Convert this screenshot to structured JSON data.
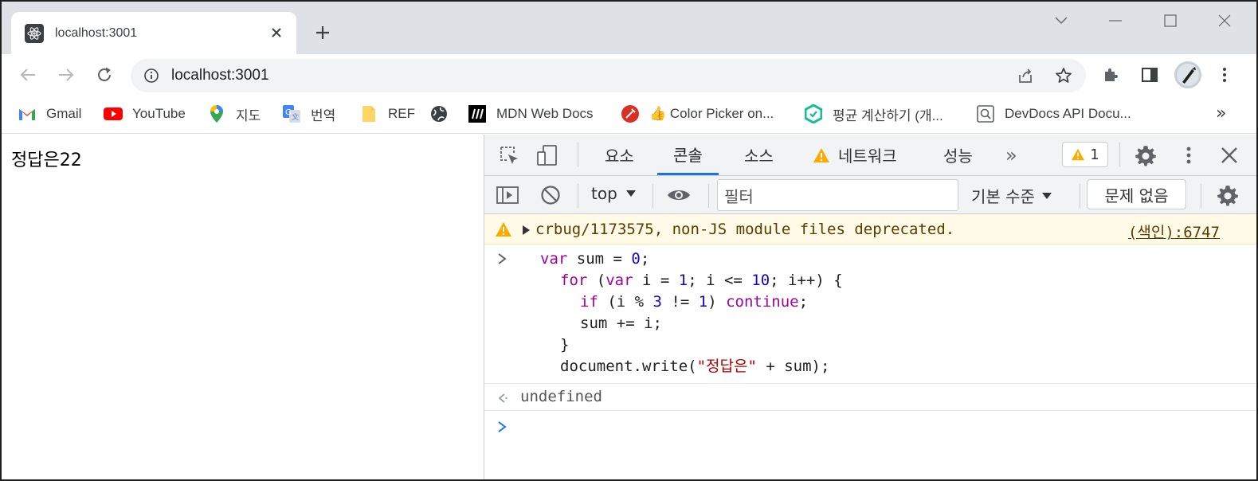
{
  "browser": {
    "tab": {
      "title": "localhost:3001"
    },
    "address_bar": {
      "url": "localhost:3001"
    },
    "bookmarks": [
      {
        "label": "Gmail",
        "icon": "gmail-icon"
      },
      {
        "label": "YouTube",
        "icon": "youtube-icon"
      },
      {
        "label": "지도",
        "icon": "maps-icon"
      },
      {
        "label": "번역",
        "icon": "translate-icon"
      },
      {
        "label": "REF",
        "icon": "folder-icon"
      },
      {
        "label": "",
        "icon": "globe-icon"
      },
      {
        "label": "MDN Web Docs",
        "icon": "mdn-icon"
      },
      {
        "label": "👍 Color Picker on...",
        "icon": "color-picker-icon"
      },
      {
        "label": "평균 계산하기 (개...",
        "icon": "hexagon-icon"
      },
      {
        "label": "DevDocs API Docu...",
        "icon": "devdocs-icon"
      }
    ],
    "bookmarks_more": "»"
  },
  "page": {
    "content_text": "정답은22"
  },
  "devtools": {
    "tabs": [
      "요소",
      "콘솔",
      "소스",
      "네트워크",
      "성능"
    ],
    "active_tab": "콘솔",
    "more_tabs": "»",
    "issues_count": "1",
    "context": "top",
    "filter_placeholder": "필터",
    "levels": "기본 수준",
    "no_issues": "문제 없음",
    "warning": {
      "text": "crbug/1173575, non-JS module files deprecated.",
      "source": "(색인):6747"
    },
    "code": {
      "line1": {
        "a": "var",
        "b": " sum = ",
        "c": "0",
        "d": ";"
      },
      "line2": {
        "a": "for",
        "b": " (",
        "c": "var",
        "d": " i = ",
        "e": "1",
        "f": "; i <= ",
        "g": "10",
        "h": "; i++) {"
      },
      "line3": {
        "a": "if",
        "b": " (i % ",
        "c": "3",
        "d": " != ",
        "e": "1",
        "f": ") ",
        "g": "continue",
        "h": ";"
      },
      "line4": "sum += i;",
      "line5": "}",
      "line6": {
        "a": "document.write(",
        "b": "\"정답은\"",
        "c": " + sum);"
      }
    },
    "result": "undefined"
  },
  "colors": {
    "accent": "#1a73e8",
    "warning_bg": "#fffbe6",
    "keyword": "#a000a0",
    "number": "#1c00cf",
    "string": "#b70000"
  }
}
